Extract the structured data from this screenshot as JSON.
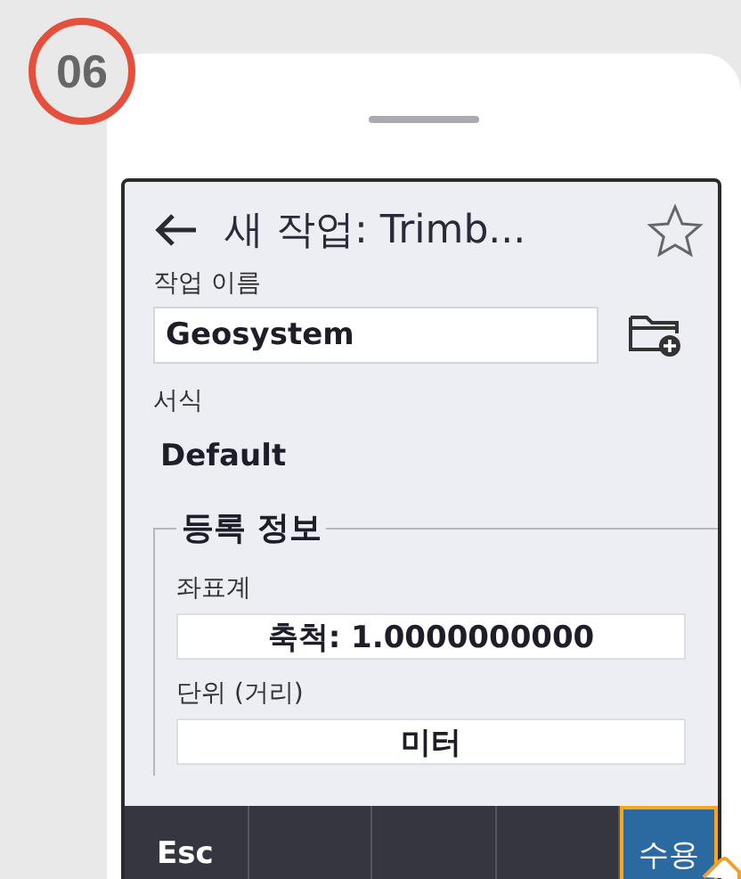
{
  "badge": "06",
  "header": {
    "title": "새 작업: Trimb...",
    "favorite": false
  },
  "job_name": {
    "label": "작업 이름",
    "value": "Geosystem"
  },
  "template": {
    "label": "서식",
    "value": "Default"
  },
  "registration": {
    "title": "등록 정보",
    "fields": [
      {
        "label": "좌표계",
        "value": "축척: 1.0000000000"
      },
      {
        "label": "단위 (거리)",
        "value": "미터"
      }
    ]
  },
  "softkeys": [
    {
      "kind": "key",
      "label": "Esc",
      "selected": false
    },
    {
      "kind": "blank",
      "selected": false
    },
    {
      "kind": "blank",
      "selected": false
    },
    {
      "kind": "blank",
      "selected": false
    },
    {
      "kind": "key",
      "label": "수용",
      "selected": true
    }
  ]
}
